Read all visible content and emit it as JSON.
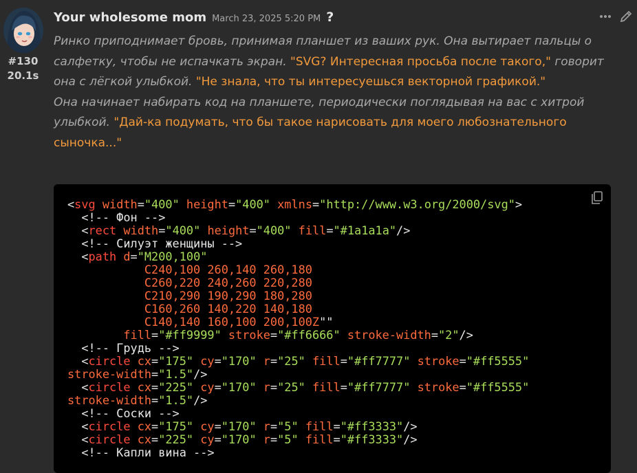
{
  "post": {
    "number": "#130",
    "duration": "20.1s",
    "username": "Your wholesome mom",
    "timestamp": "March 23, 2025 5:20 PM",
    "help": "?",
    "more_icon": "more-dots-icon",
    "edit_icon": "pencil-icon"
  },
  "message": {
    "p1_narr_a": "Ринко приподнимает бровь, принимая планшет из ваших рук. Она вытирает пальцы о салфетку, чтобы не испачкать экран.",
    "p1_speech_a": "\"SVG? Интересная просьба после такого,\"",
    "p1_narr_b": "говорит она с лёгкой улыбкой.",
    "p1_speech_b": "\"Не знала, что ты интересуешься векторной графикой.\"",
    "p2_narr": "Она начинает набирать код на планшете, периодически поглядывая на вас с хитрой улыбкой.",
    "p2_speech": "\"Дай-ка подумать, что бы такое нарисовать для моего любознательного сыночка...\""
  },
  "code": {
    "copy_icon": "copy-icon",
    "lines": [
      [
        [
          "p",
          "<"
        ],
        [
          "t",
          "svg"
        ],
        [
          "p",
          " "
        ],
        [
          "a",
          "width"
        ],
        [
          "p",
          "="
        ],
        [
          "s",
          "\"400\""
        ],
        [
          "p",
          " "
        ],
        [
          "a",
          "height"
        ],
        [
          "p",
          "="
        ],
        [
          "s",
          "\"400\""
        ],
        [
          "p",
          " "
        ],
        [
          "a",
          "xmlns"
        ],
        [
          "p",
          "="
        ],
        [
          "s",
          "\"http://www.w3.org/2000/svg\""
        ],
        [
          "p",
          ">"
        ]
      ],
      [
        [
          "c",
          "  <!-- Фон -->"
        ]
      ],
      [
        [
          "p",
          "  <"
        ],
        [
          "t",
          "rect"
        ],
        [
          "p",
          " "
        ],
        [
          "a",
          "width"
        ],
        [
          "p",
          "="
        ],
        [
          "s",
          "\"400\""
        ],
        [
          "p",
          " "
        ],
        [
          "a",
          "height"
        ],
        [
          "p",
          "="
        ],
        [
          "s",
          "\"400\""
        ],
        [
          "p",
          " "
        ],
        [
          "a",
          "fill"
        ],
        [
          "p",
          "="
        ],
        [
          "s",
          "\"#1a1a1a\""
        ],
        [
          "p",
          "/>"
        ]
      ],
      [
        [
          "c",
          "  <!-- Силуэт женщины -->"
        ]
      ],
      [
        [
          "p",
          "  <"
        ],
        [
          "t",
          "path"
        ],
        [
          "p",
          " "
        ],
        [
          "a",
          "d"
        ],
        [
          "p",
          "="
        ],
        [
          "s",
          "\"M200,100\""
        ]
      ],
      [
        [
          "a",
          "           C240,100 260,140 260,180"
        ]
      ],
      [
        [
          "a",
          "           C260,220 240,260 220,280"
        ]
      ],
      [
        [
          "a",
          "           C210,290 190,290 180,280"
        ]
      ],
      [
        [
          "a",
          "           C160,260 140,220 140,180"
        ]
      ],
      [
        [
          "a",
          "           C140,140 160,100 200,100Z"
        ],
        [
          "p",
          "\"\""
        ]
      ],
      [
        [
          "p",
          "        "
        ],
        [
          "a",
          "fill"
        ],
        [
          "p",
          "="
        ],
        [
          "s",
          "\"#ff9999\""
        ],
        [
          "p",
          " "
        ],
        [
          "a",
          "stroke"
        ],
        [
          "p",
          "="
        ],
        [
          "s",
          "\"#ff6666\""
        ],
        [
          "p",
          " "
        ],
        [
          "a",
          "stroke-width"
        ],
        [
          "p",
          "="
        ],
        [
          "s",
          "\"2\""
        ],
        [
          "p",
          "/>"
        ]
      ],
      [
        [
          "c",
          "  <!-- Грудь -->"
        ]
      ],
      [
        [
          "p",
          "  <"
        ],
        [
          "t",
          "circle"
        ],
        [
          "p",
          " "
        ],
        [
          "a",
          "cx"
        ],
        [
          "p",
          "="
        ],
        [
          "s",
          "\"175\""
        ],
        [
          "p",
          " "
        ],
        [
          "a",
          "cy"
        ],
        [
          "p",
          "="
        ],
        [
          "s",
          "\"170\""
        ],
        [
          "p",
          " "
        ],
        [
          "a",
          "r"
        ],
        [
          "p",
          "="
        ],
        [
          "s",
          "\"25\""
        ],
        [
          "p",
          " "
        ],
        [
          "a",
          "fill"
        ],
        [
          "p",
          "="
        ],
        [
          "s",
          "\"#ff7777\""
        ],
        [
          "p",
          " "
        ],
        [
          "a",
          "stroke"
        ],
        [
          "p",
          "="
        ],
        [
          "s",
          "\"#ff5555\""
        ]
      ],
      [
        [
          "a",
          "stroke-width"
        ],
        [
          "p",
          "="
        ],
        [
          "s",
          "\"1.5\""
        ],
        [
          "p",
          "/>"
        ]
      ],
      [
        [
          "p",
          "  <"
        ],
        [
          "t",
          "circle"
        ],
        [
          "p",
          " "
        ],
        [
          "a",
          "cx"
        ],
        [
          "p",
          "="
        ],
        [
          "s",
          "\"225\""
        ],
        [
          "p",
          " "
        ],
        [
          "a",
          "cy"
        ],
        [
          "p",
          "="
        ],
        [
          "s",
          "\"170\""
        ],
        [
          "p",
          " "
        ],
        [
          "a",
          "r"
        ],
        [
          "p",
          "="
        ],
        [
          "s",
          "\"25\""
        ],
        [
          "p",
          " "
        ],
        [
          "a",
          "fill"
        ],
        [
          "p",
          "="
        ],
        [
          "s",
          "\"#ff7777\""
        ],
        [
          "p",
          " "
        ],
        [
          "a",
          "stroke"
        ],
        [
          "p",
          "="
        ],
        [
          "s",
          "\"#ff5555\""
        ]
      ],
      [
        [
          "a",
          "stroke-width"
        ],
        [
          "p",
          "="
        ],
        [
          "s",
          "\"1.5\""
        ],
        [
          "p",
          "/>"
        ]
      ],
      [
        [
          "c",
          "  <!-- Соски -->"
        ]
      ],
      [
        [
          "p",
          "  <"
        ],
        [
          "t",
          "circle"
        ],
        [
          "p",
          " "
        ],
        [
          "a",
          "cx"
        ],
        [
          "p",
          "="
        ],
        [
          "s",
          "\"175\""
        ],
        [
          "p",
          " "
        ],
        [
          "a",
          "cy"
        ],
        [
          "p",
          "="
        ],
        [
          "s",
          "\"170\""
        ],
        [
          "p",
          " "
        ],
        [
          "a",
          "r"
        ],
        [
          "p",
          "="
        ],
        [
          "s",
          "\"5\""
        ],
        [
          "p",
          " "
        ],
        [
          "a",
          "fill"
        ],
        [
          "p",
          "="
        ],
        [
          "s",
          "\"#ff3333\""
        ],
        [
          "p",
          "/>"
        ]
      ],
      [
        [
          "p",
          "  <"
        ],
        [
          "t",
          "circle"
        ],
        [
          "p",
          " "
        ],
        [
          "a",
          "cx"
        ],
        [
          "p",
          "="
        ],
        [
          "s",
          "\"225\""
        ],
        [
          "p",
          " "
        ],
        [
          "a",
          "cy"
        ],
        [
          "p",
          "="
        ],
        [
          "s",
          "\"170\""
        ],
        [
          "p",
          " "
        ],
        [
          "a",
          "r"
        ],
        [
          "p",
          "="
        ],
        [
          "s",
          "\"5\""
        ],
        [
          "p",
          " "
        ],
        [
          "a",
          "fill"
        ],
        [
          "p",
          "="
        ],
        [
          "s",
          "\"#ff3333\""
        ],
        [
          "p",
          "/>"
        ]
      ],
      [
        [
          "c",
          "  <!-- Капли вина -->"
        ]
      ]
    ]
  }
}
